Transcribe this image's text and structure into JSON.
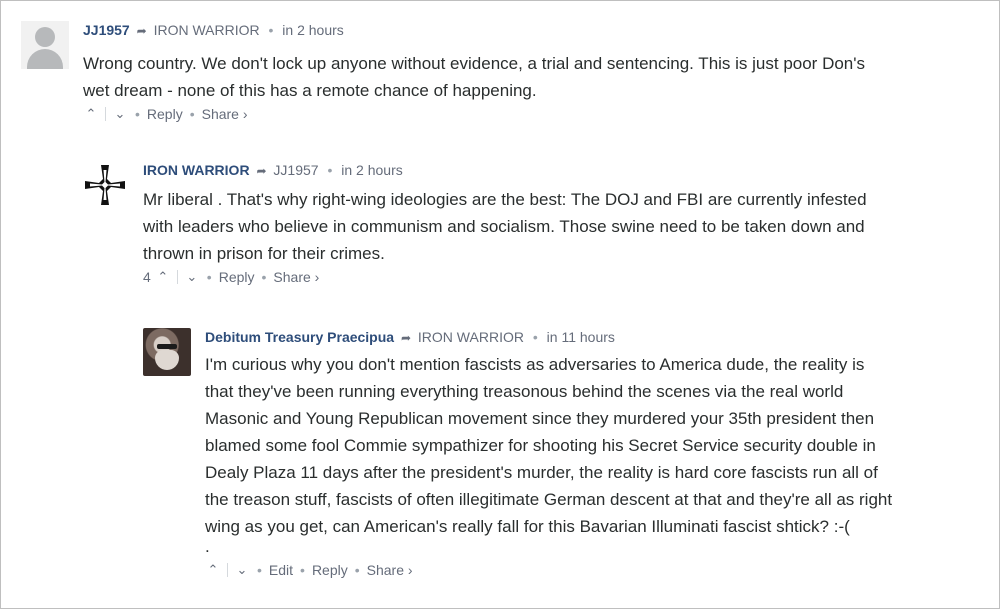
{
  "comments": [
    {
      "author": "JJ1957",
      "reply_to": "IRON WARRIOR",
      "time": "in 2 hours",
      "lines": [
        "Wrong country. We don't lock up anyone without evidence, a trial and sentencing. This is just poor Don's",
        "wet dream - none of this has a remote chance of happening."
      ],
      "score": "",
      "actions": {
        "reply": "Reply",
        "share": "Share ›"
      }
    },
    {
      "author": "IRON WARRIOR",
      "reply_to": "JJ1957",
      "time": "in 2 hours",
      "lines": [
        "Mr liberal . That's why right-wing ideologies are the best: The DOJ and FBI are currently infested",
        "with leaders who believe in communism and socialism. Those swine need to be taken down and",
        "thrown in prison for their crimes."
      ],
      "score": "4",
      "actions": {
        "reply": "Reply",
        "share": "Share ›"
      }
    },
    {
      "author": "Debitum Treasury Praecipua",
      "reply_to": "IRON WARRIOR",
      "time": "in 11 hours",
      "lines": [
        "I'm curious why you don't mention fascists as adversaries to America dude, the reality is",
        "that they've been running everything treasonous behind the scenes via the real world",
        "Masonic and Young Republican movement since they murdered your 35th president then",
        "blamed some fool Commie sympathizer for shooting his Secret Service security double in",
        "Dealy Plaza 11 days after the president's murder, the reality is hard core fascists run all of",
        "the treason stuff, fascists of often illegitimate German descent at that and they're all as right",
        "wing as you get, can American's really fall for this Bavarian Illuminati fascist shtick? :-(",
        "."
      ],
      "score": "",
      "actions": {
        "edit": "Edit",
        "reply": "Reply",
        "share": "Share ›"
      }
    }
  ],
  "icons": {
    "upvote": "chevron-up-icon",
    "downvote": "chevron-down-icon",
    "reply_arrow": "reply-arrow-icon"
  },
  "colors": {
    "author": "#2e4d7a",
    "meta": "#656c7a",
    "text": "#2a2e2e"
  }
}
